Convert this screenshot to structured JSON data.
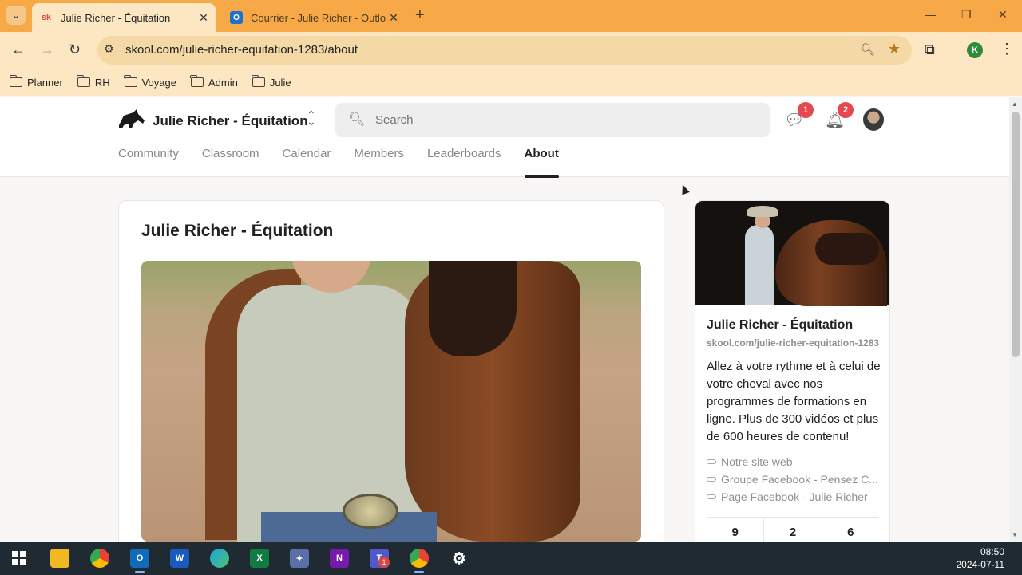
{
  "browser": {
    "tabs": [
      {
        "favicon": "sk",
        "title": "Julie Richer - Équitation",
        "active": true
      },
      {
        "favicon": "O",
        "title": "Courrier - Julie Richer - Outlook",
        "active": false
      }
    ],
    "url": "skool.com/julie-richer-equitation-1283/about",
    "profile_initial": "K",
    "bookmarks": [
      "Planner",
      "RH",
      "Voyage",
      "Admin",
      "Julie"
    ]
  },
  "header": {
    "group_name": "Julie Richer - Équitation",
    "search_placeholder": "Search",
    "chat_badge": "1",
    "notif_badge": "2",
    "nav": [
      "Community",
      "Classroom",
      "Calendar",
      "Members",
      "Leaderboards",
      "About"
    ],
    "active_nav": "About"
  },
  "main": {
    "title": "Julie Richer - Équitation"
  },
  "sidebar": {
    "name": "Julie Richer - Équitation",
    "slug": "skool.com/julie-richer-equitation-1283",
    "description": "Allez à votre rythme et à celui de votre cheval avec nos programmes de formations en ligne. Plus de 300 vidéos et plus de 600 heures de contenu!",
    "links": [
      "Notre site web",
      "Groupe Facebook - Pensez C...",
      "Page Facebook - Julie Richer"
    ],
    "stats": [
      "9",
      "2",
      "6"
    ]
  },
  "taskbar": {
    "teams_badge": "1",
    "time": "08:50",
    "date": "2024-07-11"
  },
  "colors": {
    "chrome_frame": "#f7a948",
    "chrome_toolbar": "#fde7c3",
    "badge": "#e5484d",
    "taskbar": "#1f2a33"
  }
}
